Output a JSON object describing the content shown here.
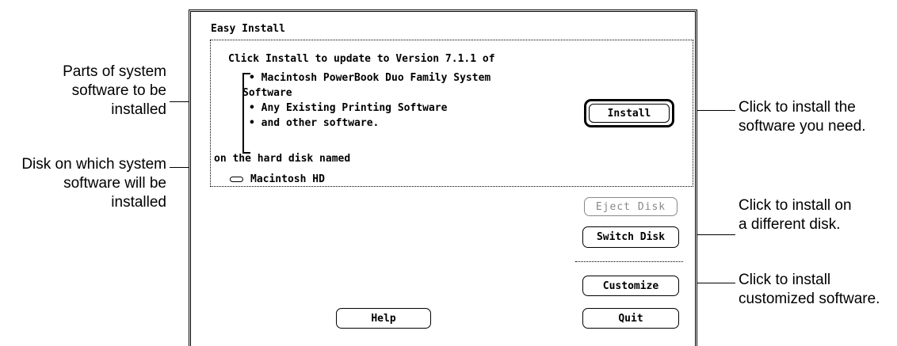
{
  "callouts": {
    "system_parts": [
      "Parts of system",
      "software to be",
      "installed"
    ],
    "disk": [
      "Disk on which system",
      "software will be",
      "installed"
    ],
    "install": [
      "Click to install the",
      "software you need."
    ],
    "switch": [
      "Click to install on",
      "a different disk."
    ],
    "customize": [
      "Click to install",
      "customized software."
    ]
  },
  "window": {
    "title": "Easy Install",
    "intro": "Click Install to update to Version 7.1.1 of",
    "items": [
      "• Macintosh PowerBook Duo Family System",
      "Software",
      "• Any Existing Printing Software",
      "• and other software."
    ],
    "disk_label": "on the hard disk named",
    "disk_name": "Macintosh HD",
    "disk_icon": "hard-disk-icon"
  },
  "buttons": {
    "install": "Install",
    "eject": "Eject Disk",
    "switch": "Switch Disk",
    "customize": "Customize",
    "help": "Help",
    "quit": "Quit"
  }
}
